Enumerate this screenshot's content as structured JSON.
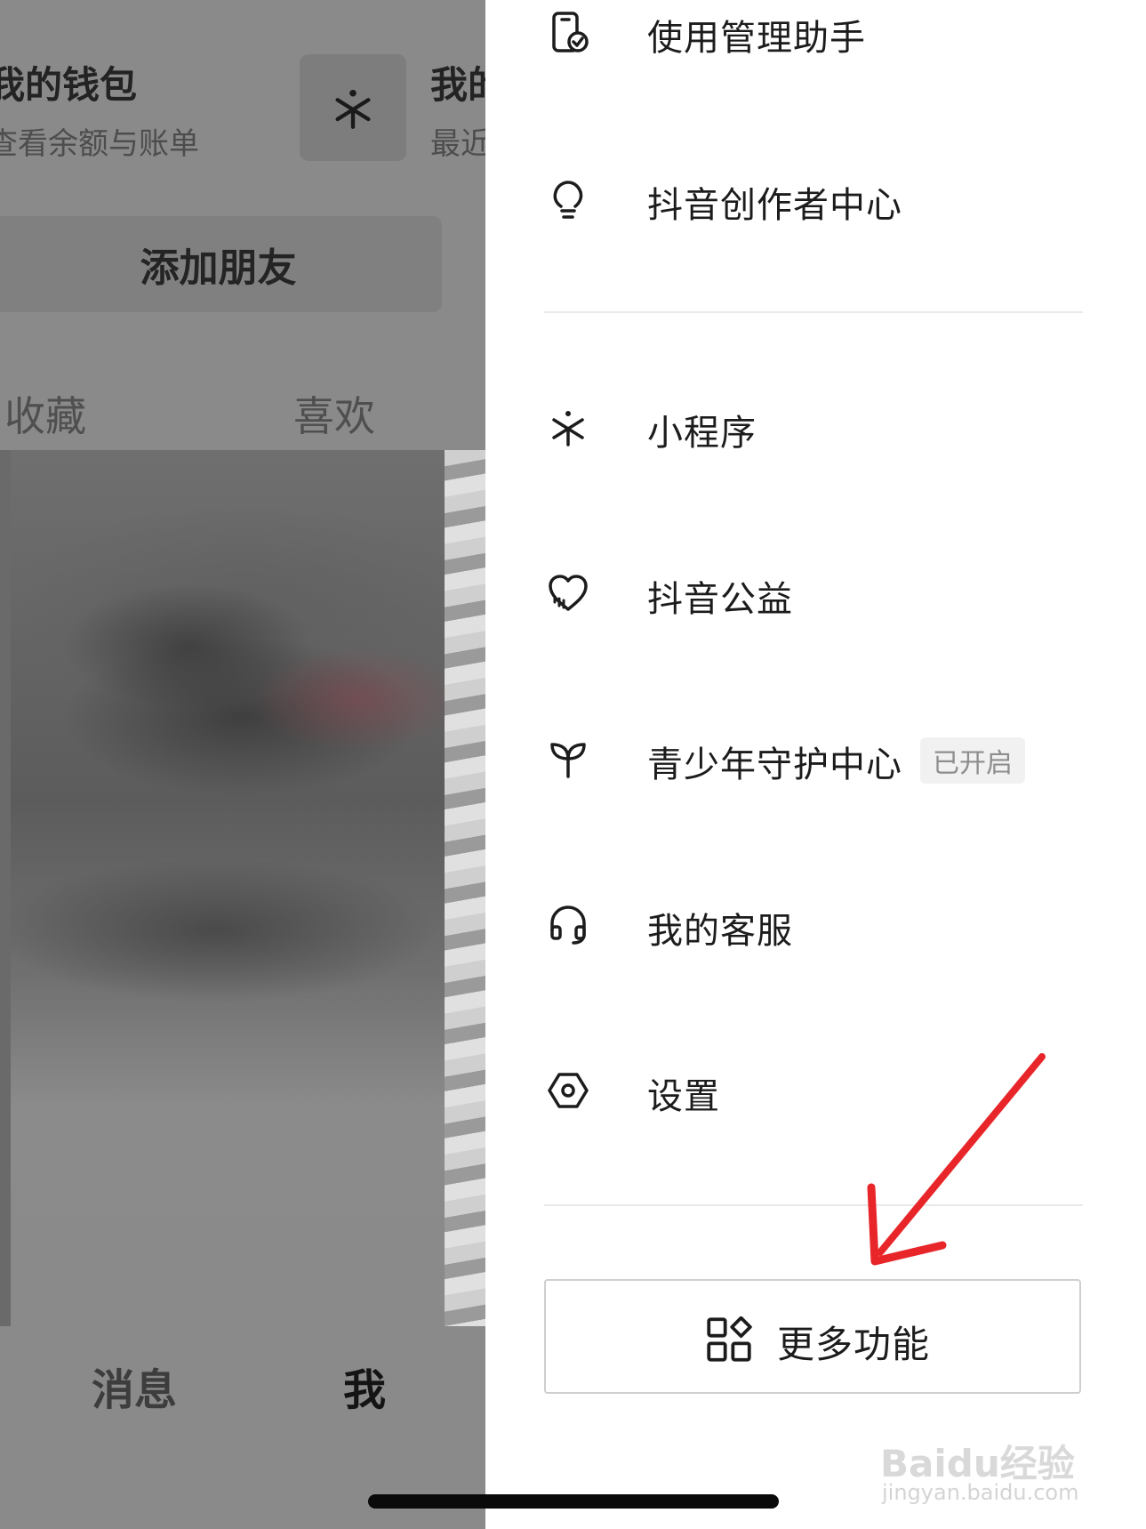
{
  "background_page": {
    "wallet": {
      "title": "我的钱包",
      "subtitle": "查看余额与账单"
    },
    "right_card": {
      "title": "我的",
      "subtitle": "最近"
    },
    "add_friend": "添加朋友",
    "tabs": [
      "收藏",
      "喜欢"
    ],
    "bottom_nav": {
      "messages": "消息",
      "me": "我"
    }
  },
  "drawer": {
    "items": [
      {
        "label": "使用管理助手",
        "icon": "phone-check-icon"
      },
      {
        "label": "抖音创作者中心",
        "icon": "lightbulb-icon"
      },
      {
        "label": "小程序",
        "icon": "mini-program-icon"
      },
      {
        "label": "抖音公益",
        "icon": "charity-heart-icon"
      },
      {
        "label": "青少年守护中心",
        "icon": "sprout-icon",
        "badge": "已开启"
      },
      {
        "label": "我的客服",
        "icon": "headset-icon"
      },
      {
        "label": "设置",
        "icon": "settings-hexagon-icon"
      }
    ],
    "more_button": {
      "label": "更多功能",
      "icon": "grid-apps-icon"
    }
  },
  "annotation": {
    "color": "#e8262a",
    "icon": "red-arrow-icon"
  },
  "watermark": {
    "text": "Baidu经验",
    "sub": "jingyan.baidu.com"
  }
}
